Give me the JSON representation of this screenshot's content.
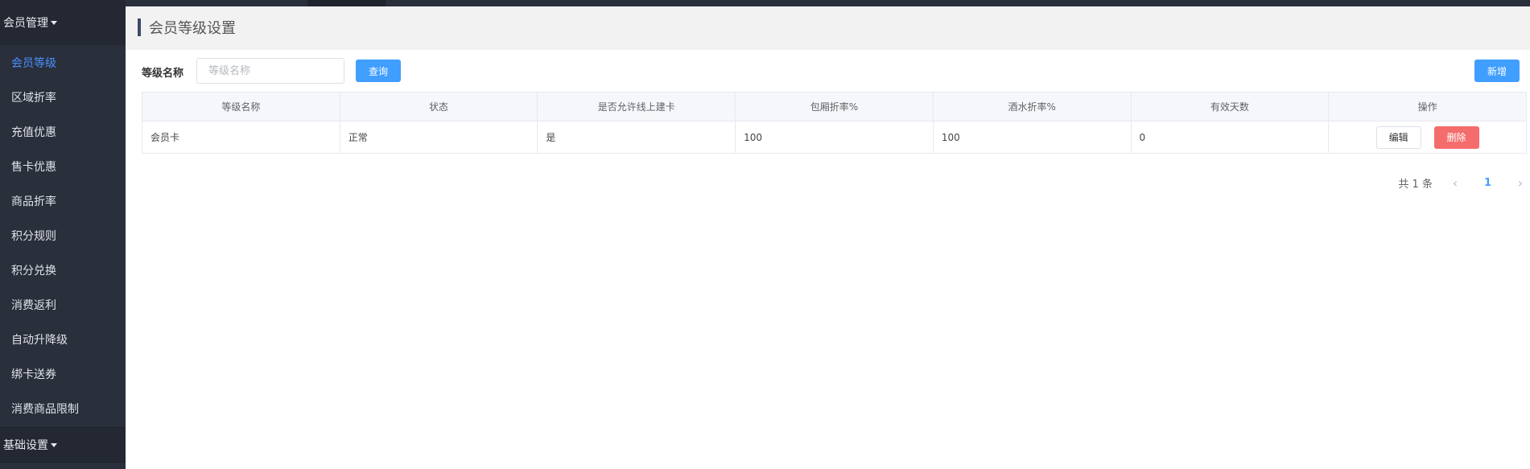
{
  "sidebar": {
    "group1_label": "会员管理",
    "items": [
      {
        "label": "会员等级",
        "active": true
      },
      {
        "label": "区域折率"
      },
      {
        "label": "充值优惠"
      },
      {
        "label": "售卡优惠"
      },
      {
        "label": "商品折率"
      },
      {
        "label": "积分规则"
      },
      {
        "label": "积分兑换"
      },
      {
        "label": "消费返利"
      },
      {
        "label": "自动升降级"
      },
      {
        "label": "绑卡送券"
      },
      {
        "label": "消费商品限制"
      }
    ],
    "group2_label": "基础设置"
  },
  "page": {
    "title": "会员等级设置"
  },
  "filter": {
    "label": "等级名称",
    "placeholder": "等级名称",
    "value": "",
    "query_label": "查询",
    "add_label": "新增"
  },
  "table": {
    "columns": [
      "等级名称",
      "状态",
      "是否允许线上建卡",
      "包厢折率%",
      "酒水折率%",
      "有效天数",
      "操作"
    ],
    "rows": [
      {
        "name": "会员卡",
        "status": "正常",
        "online": "是",
        "room_rate": "100",
        "drink_rate": "100",
        "days": "0"
      }
    ],
    "edit_label": "编辑",
    "delete_label": "删除"
  },
  "pagination": {
    "total_text": "共 1 条",
    "current_page": "1",
    "prev_icon": "‹",
    "next_icon": "›"
  },
  "colors": {
    "sidebar_bg": "#2a2f3c",
    "active_menu": "#4a90ff",
    "primary": "#409eff",
    "danger": "#f56c6c"
  }
}
